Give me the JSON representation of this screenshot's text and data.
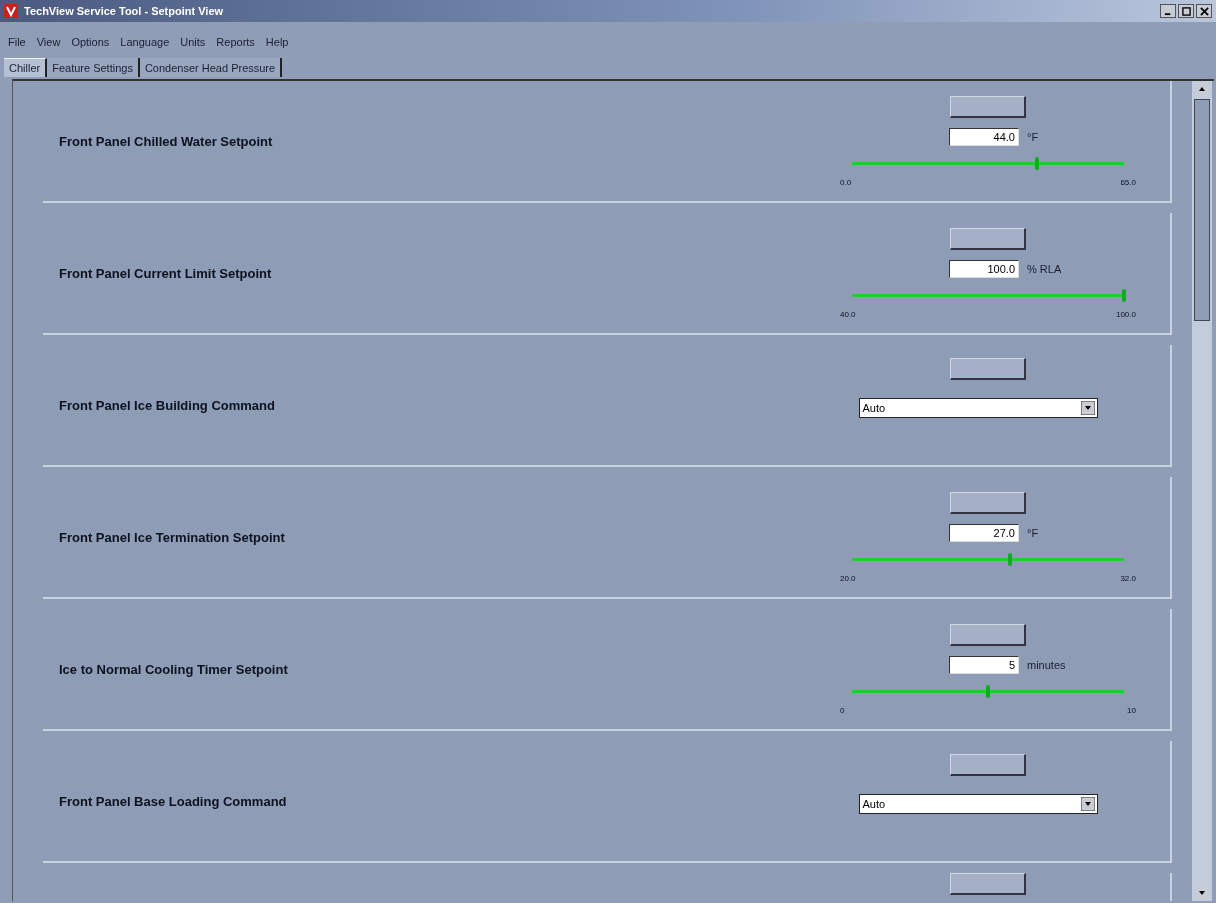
{
  "window": {
    "title": "TechView Service Tool - Setpoint View"
  },
  "menu": [
    "File",
    "View",
    "Options",
    "Language",
    "Units",
    "Reports",
    "Help"
  ],
  "tabs": [
    {
      "label": "Chiller",
      "selected": true
    },
    {
      "label": "Feature Settings",
      "selected": false
    },
    {
      "label": "Condenser Head Pressure",
      "selected": false
    }
  ],
  "setpoints": [
    {
      "kind": "numeric",
      "label": "Front Panel Chilled Water Setpoint",
      "value": "44.0",
      "unit": "°F",
      "level": 0.68,
      "min": "0.0",
      "max": "65.0"
    },
    {
      "kind": "numeric",
      "label": "Front Panel Current Limit Setpoint",
      "value": "100.0",
      "unit": "% RLA",
      "level": 1,
      "min": "40.0",
      "max": "100.0"
    },
    {
      "kind": "choice",
      "label": "Front Panel Ice Building Command",
      "value": "Auto"
    },
    {
      "kind": "numeric",
      "label": "Front Panel Ice Termination Setpoint",
      "value": "27.0",
      "unit": "°F",
      "level": 0.58,
      "min": "20.0",
      "max": "32.0"
    },
    {
      "kind": "numeric",
      "label": "Ice to Normal Cooling Timer Setpoint",
      "value": "5",
      "unit": "minutes",
      "level": 0.5,
      "min": "0",
      "max": "10"
    },
    {
      "kind": "choice",
      "label": "Front Panel Base Loading Command",
      "value": "Auto"
    },
    {
      "kind": "cutoff"
    }
  ]
}
